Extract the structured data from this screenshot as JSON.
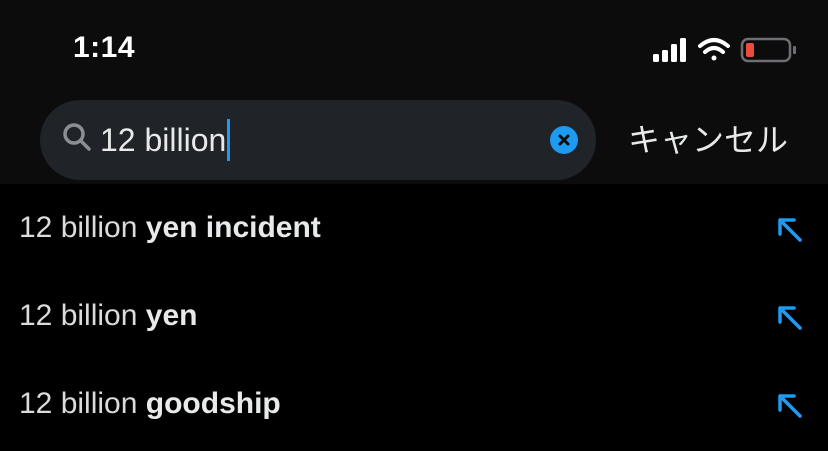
{
  "status_bar": {
    "time": "1:14",
    "icons": [
      "signal-icon",
      "wifi-icon",
      "battery-icon"
    ],
    "battery_color": "#eb4d3d"
  },
  "search": {
    "query": "12 billion",
    "clear_icon": "clear-icon",
    "cancel_label": "キャンセル",
    "accent": "#1d9bf0"
  },
  "suggestions": [
    {
      "prefix": "12 billion",
      "completion": "yen incident",
      "icon": "arrow-up-left-icon"
    },
    {
      "prefix": "12 billion",
      "completion": "yen",
      "icon": "arrow-up-left-icon"
    },
    {
      "prefix": "12 billion",
      "completion": "goodship",
      "icon": "arrow-up-left-icon"
    }
  ]
}
